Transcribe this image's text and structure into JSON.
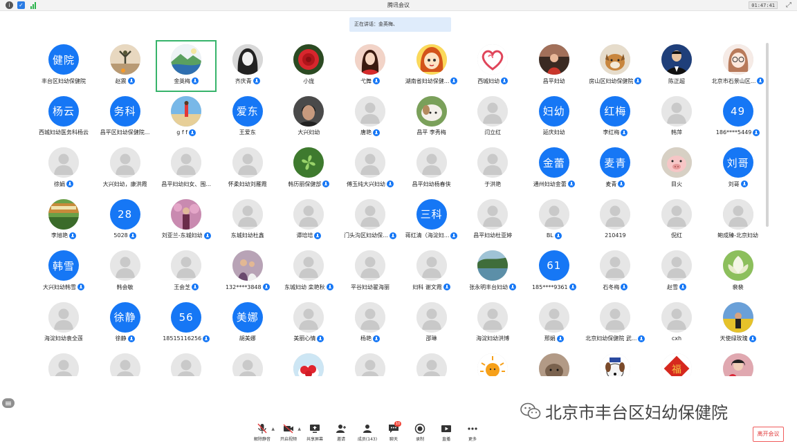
{
  "window": {
    "title": "腾讯会议",
    "clock": "01:47:41"
  },
  "speaking_banner": "正在讲话：金英梅、",
  "participants": [
    {
      "name": "丰台区妇幼保健院",
      "avatar_type": "text",
      "avatar_text": "健院",
      "mic": false
    },
    {
      "name": "赵震",
      "avatar_type": "photo",
      "photo": "person-stretch",
      "mic": true
    },
    {
      "name": "金英梅",
      "avatar_type": "photo",
      "photo": "landscape",
      "mic": true,
      "active": true
    },
    {
      "name": "齐庆青",
      "avatar_type": "photo",
      "photo": "bw-portrait",
      "mic": true
    },
    {
      "name": "小庞",
      "avatar_type": "photo",
      "photo": "red-flower",
      "mic": false
    },
    {
      "name": "弋舞",
      "avatar_type": "photo",
      "photo": "woman-red",
      "mic": true
    },
    {
      "name": "湖南省妇幼保健...",
      "avatar_type": "photo",
      "photo": "cartoon-girl",
      "mic": true
    },
    {
      "name": "西城妇幼",
      "avatar_type": "photo",
      "photo": "heart",
      "mic": true
    },
    {
      "name": "昌平妇幼",
      "avatar_type": "photo",
      "photo": "woman-sunset",
      "mic": false
    },
    {
      "name": "房山区妇幼保健院",
      "avatar_type": "photo",
      "photo": "dog",
      "mic": true
    },
    {
      "name": "陈正超",
      "avatar_type": "photo",
      "photo": "man-suit",
      "mic": false
    },
    {
      "name": "北京市石景山区...",
      "avatar_type": "photo",
      "photo": "cartoon-glasses",
      "mic": true
    },
    {
      "name": "西城妇幼医务科杨云",
      "avatar_type": "text",
      "avatar_text": "杨云",
      "mic": false
    },
    {
      "name": "昌平区妇幼保健院...",
      "avatar_type": "text",
      "avatar_text": "务科",
      "mic": false
    },
    {
      "name": "g f f",
      "avatar_type": "photo",
      "photo": "beach-girl",
      "mic": true
    },
    {
      "name": "王爱东",
      "avatar_type": "text",
      "avatar_text": "爱东",
      "mic": false
    },
    {
      "name": "大兴妇幼",
      "avatar_type": "photo",
      "photo": "man-face",
      "mic": false
    },
    {
      "name": "唐艳",
      "avatar_type": "default",
      "mic": true
    },
    {
      "name": "昌平 李秀梅",
      "avatar_type": "photo",
      "photo": "puppy",
      "mic": false
    },
    {
      "name": "闫立红",
      "avatar_type": "default",
      "mic": false
    },
    {
      "name": "延庆妇幼",
      "avatar_type": "text",
      "avatar_text": "妇幼",
      "mic": false
    },
    {
      "name": "李红梅",
      "avatar_type": "text",
      "avatar_text": "红梅",
      "mic": true
    },
    {
      "name": "韩萍",
      "avatar_type": "default",
      "mic": false
    },
    {
      "name": "186****5449",
      "avatar_type": "text",
      "avatar_text": "49",
      "mic": true
    },
    {
      "name": "徐娟",
      "avatar_type": "default",
      "mic": true
    },
    {
      "name": "大兴妇幼，康洪霞",
      "avatar_type": "default",
      "mic": false
    },
    {
      "name": "昌平妇幼妇女、围...",
      "avatar_type": "default",
      "mic": false
    },
    {
      "name": "怀柔妇幼刘雁霞",
      "avatar_type": "default",
      "mic": false
    },
    {
      "name": "韩历丽保健部",
      "avatar_type": "photo",
      "photo": "green-plant",
      "mic": true
    },
    {
      "name": "傅玉纯大兴妇幼",
      "avatar_type": "default",
      "mic": true
    },
    {
      "name": "昌平妇幼杨春侠",
      "avatar_type": "default",
      "mic": false
    },
    {
      "name": "于洪艳",
      "avatar_type": "default",
      "mic": false
    },
    {
      "name": "通州妇幼金蕾",
      "avatar_type": "text",
      "avatar_text": "金蕾",
      "mic": true
    },
    {
      "name": "麦青",
      "avatar_type": "text",
      "avatar_text": "麦青",
      "mic": true
    },
    {
      "name": "目火",
      "avatar_type": "photo",
      "photo": "pig",
      "mic": false
    },
    {
      "name": "刘哥",
      "avatar_type": "text",
      "avatar_text": "刘哥",
      "mic": true
    },
    {
      "name": "李旭艳",
      "avatar_type": "photo",
      "photo": "school-gate",
      "mic": true
    },
    {
      "name": "5028",
      "avatar_type": "text",
      "avatar_text": "28",
      "mic": true
    },
    {
      "name": "刘亚兰-东城妇幼",
      "avatar_type": "photo",
      "photo": "woman-flowers",
      "mic": true
    },
    {
      "name": "东城妇幼杜鑫",
      "avatar_type": "default",
      "mic": false
    },
    {
      "name": "谭培培",
      "avatar_type": "default",
      "mic": true
    },
    {
      "name": "门头沟区妇幼保...",
      "avatar_type": "default",
      "mic": true
    },
    {
      "name": "蒋红清（海淀妇...",
      "avatar_type": "text",
      "avatar_text": "三科",
      "mic": true
    },
    {
      "name": "昌平妇幼杜亚婷",
      "avatar_type": "default",
      "mic": false
    },
    {
      "name": "BL",
      "avatar_type": "default",
      "mic": true
    },
    {
      "name": "210419",
      "avatar_type": "default",
      "mic": false
    },
    {
      "name": "倪红",
      "avatar_type": "default",
      "mic": false
    },
    {
      "name": "鲍成臻-北京妇幼",
      "avatar_type": "photo",
      "photo": "groundhog",
      "mic": false
    },
    {
      "name": "大兴妇幼韩雪",
      "avatar_type": "text",
      "avatar_text": "韩雪",
      "mic": true
    },
    {
      "name": "韩会敏",
      "avatar_type": "default",
      "mic": false
    },
    {
      "name": "王会芝",
      "avatar_type": "default",
      "mic": true
    },
    {
      "name": "132****3848",
      "avatar_type": "photo",
      "photo": "family",
      "mic": true
    },
    {
      "name": "东城妇幼 栾艳秋",
      "avatar_type": "default",
      "mic": true
    },
    {
      "name": "平谷妇幼翟海丽",
      "avatar_type": "default",
      "mic": false
    },
    {
      "name": "妇科 谢文霞",
      "avatar_type": "default",
      "mic": true
    },
    {
      "name": "张永明丰台妇幼",
      "avatar_type": "photo",
      "photo": "lake",
      "mic": true
    },
    {
      "name": "185****9361",
      "avatar_type": "text",
      "avatar_text": "61",
      "mic": true
    },
    {
      "name": "石冬梅",
      "avatar_type": "default",
      "mic": true
    },
    {
      "name": "赵雪",
      "avatar_type": "default",
      "mic": true
    },
    {
      "name": "裴裴",
      "avatar_type": "photo",
      "photo": "lotus",
      "mic": false
    },
    {
      "name": "海淀妇幼袁全莲",
      "avatar_type": "default",
      "mic": false
    },
    {
      "name": "徐静",
      "avatar_type": "text",
      "avatar_text": "徐静",
      "mic": true
    },
    {
      "name": "18515116256",
      "avatar_type": "text",
      "avatar_text": "56",
      "mic": true
    },
    {
      "name": "胡美娜",
      "avatar_type": "text",
      "avatar_text": "美娜",
      "mic": false
    },
    {
      "name": "美丽心情",
      "avatar_type": "default",
      "mic": true
    },
    {
      "name": "杨艳",
      "avatar_type": "default",
      "mic": true
    },
    {
      "name": "邵琳",
      "avatar_type": "default",
      "mic": false
    },
    {
      "name": "海淀妇幼洪博",
      "avatar_type": "default",
      "mic": false
    },
    {
      "name": "邢娟",
      "avatar_type": "default",
      "mic": true
    },
    {
      "name": "北京妇幼保健院 武...",
      "avatar_type": "default",
      "mic": true
    },
    {
      "name": "cxh",
      "avatar_type": "default",
      "mic": false
    },
    {
      "name": "天使绿玫瑰",
      "avatar_type": "photo",
      "photo": "flower-field",
      "mic": true
    },
    {
      "name": "",
      "avatar_type": "default",
      "mic": false
    },
    {
      "name": "",
      "avatar_type": "default",
      "mic": false
    },
    {
      "name": "",
      "avatar_type": "default",
      "mic": false
    },
    {
      "name": "",
      "avatar_type": "default",
      "mic": false
    },
    {
      "name": "",
      "avatar_type": "photo",
      "photo": "strawberry",
      "mic": false
    },
    {
      "name": "",
      "avatar_type": "default",
      "mic": false
    },
    {
      "name": "",
      "avatar_type": "default",
      "mic": false
    },
    {
      "name": "",
      "avatar_type": "photo",
      "photo": "sun",
      "mic": false
    },
    {
      "name": "",
      "avatar_type": "photo",
      "photo": "cat-photo",
      "mic": false
    },
    {
      "name": "",
      "avatar_type": "photo",
      "photo": "cartoon-dog",
      "mic": false
    },
    {
      "name": "",
      "avatar_type": "photo",
      "photo": "fu-character",
      "mic": false
    },
    {
      "name": "",
      "avatar_type": "photo",
      "photo": "woman-rose",
      "mic": false
    }
  ],
  "watermark": "北京市丰台区妇幼保健院",
  "toolbar": [
    {
      "id": "unmute",
      "label": "解除静音",
      "icon": "mic-muted-icon",
      "caret": true
    },
    {
      "id": "video",
      "label": "开启视频",
      "icon": "camera-off-icon",
      "caret": true
    },
    {
      "id": "share",
      "label": "共享屏幕",
      "icon": "screen-share-icon"
    },
    {
      "id": "invite",
      "label": "邀请",
      "icon": "add-user-icon"
    },
    {
      "id": "members",
      "label": "成员(143)",
      "icon": "members-icon"
    },
    {
      "id": "chat",
      "label": "聊天",
      "icon": "chat-icon",
      "badge": "10"
    },
    {
      "id": "record",
      "label": "录制",
      "icon": "record-icon"
    },
    {
      "id": "live",
      "label": "直播",
      "icon": "live-icon"
    },
    {
      "id": "more",
      "label": "更多",
      "icon": "more-icon"
    }
  ],
  "leave_button": "离开会议",
  "colors": {
    "accent": "#1677f5",
    "active_border": "#36b36a",
    "leave": "#e03c3c",
    "banner": "#dfecfb"
  }
}
